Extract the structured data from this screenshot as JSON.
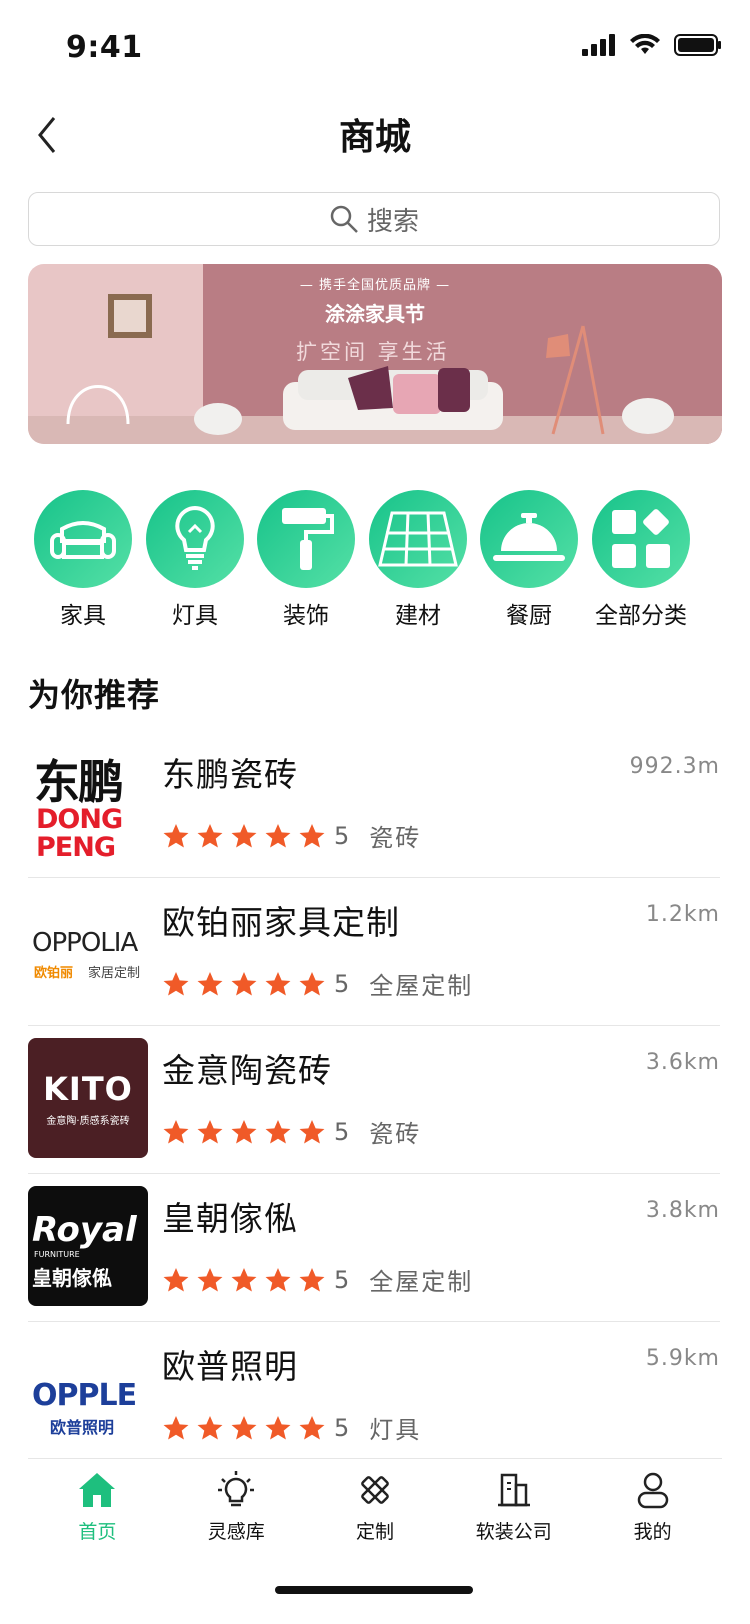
{
  "status": {
    "time": "9:41"
  },
  "nav": {
    "title": "商城"
  },
  "search": {
    "placeholder": "搜索"
  },
  "banner": {
    "tag": "— 携手全国优质品牌 —",
    "title": "涂涂家具节",
    "subtitle": "扩空间 享生活"
  },
  "categories": [
    {
      "label": "家具",
      "icon": "sofa-icon"
    },
    {
      "label": "灯具",
      "icon": "lightbulb-icon"
    },
    {
      "label": "装饰",
      "icon": "paint-roller-icon"
    },
    {
      "label": "建材",
      "icon": "flooring-icon"
    },
    {
      "label": "餐厨",
      "icon": "cloche-icon"
    },
    {
      "label": "全部分类",
      "icon": "grid-icon"
    }
  ],
  "section": {
    "title": "为你推荐"
  },
  "recommendations": [
    {
      "name": "东鹏瓷砖",
      "distance": "992.3m",
      "score": "5",
      "category": "瓷砖",
      "logo": {
        "line1": "东鹏",
        "line2": "DONG",
        "line3": "PENG"
      }
    },
    {
      "name": "欧铂丽家具定制",
      "distance": "1.2km",
      "score": "5",
      "category": "全屋定制",
      "logo": {
        "line1": "OPPOLIA",
        "line2": "欧铂丽",
        "line3": "家居定制"
      }
    },
    {
      "name": "金意陶瓷砖",
      "distance": "3.6km",
      "score": "5",
      "category": "瓷砖",
      "logo": {
        "line1": "KITO",
        "line2": "金意陶·质感系瓷砖"
      }
    },
    {
      "name": "皇朝傢俬",
      "distance": "3.8km",
      "score": "5",
      "category": "全屋定制",
      "logo": {
        "line1": "Royal",
        "line2": "FURNITURE",
        "line3": "皇朝傢俬"
      }
    },
    {
      "name": "欧普照明",
      "distance": "5.9km",
      "score": "5",
      "category": "灯具",
      "logo": {
        "line1": "OPPLE",
        "line2": "欧普照明"
      }
    }
  ],
  "tabs": [
    {
      "label": "首页",
      "icon": "home-icon",
      "active": true
    },
    {
      "label": "灵感库",
      "icon": "idea-bulb-icon",
      "active": false
    },
    {
      "label": "定制",
      "icon": "tools-icon",
      "active": false
    },
    {
      "label": "软装公司",
      "icon": "building-icon",
      "active": false
    },
    {
      "label": "我的",
      "icon": "user-icon",
      "active": false
    }
  ],
  "colors": {
    "accent": "#1ebf7e",
    "star": "#f05a28"
  }
}
